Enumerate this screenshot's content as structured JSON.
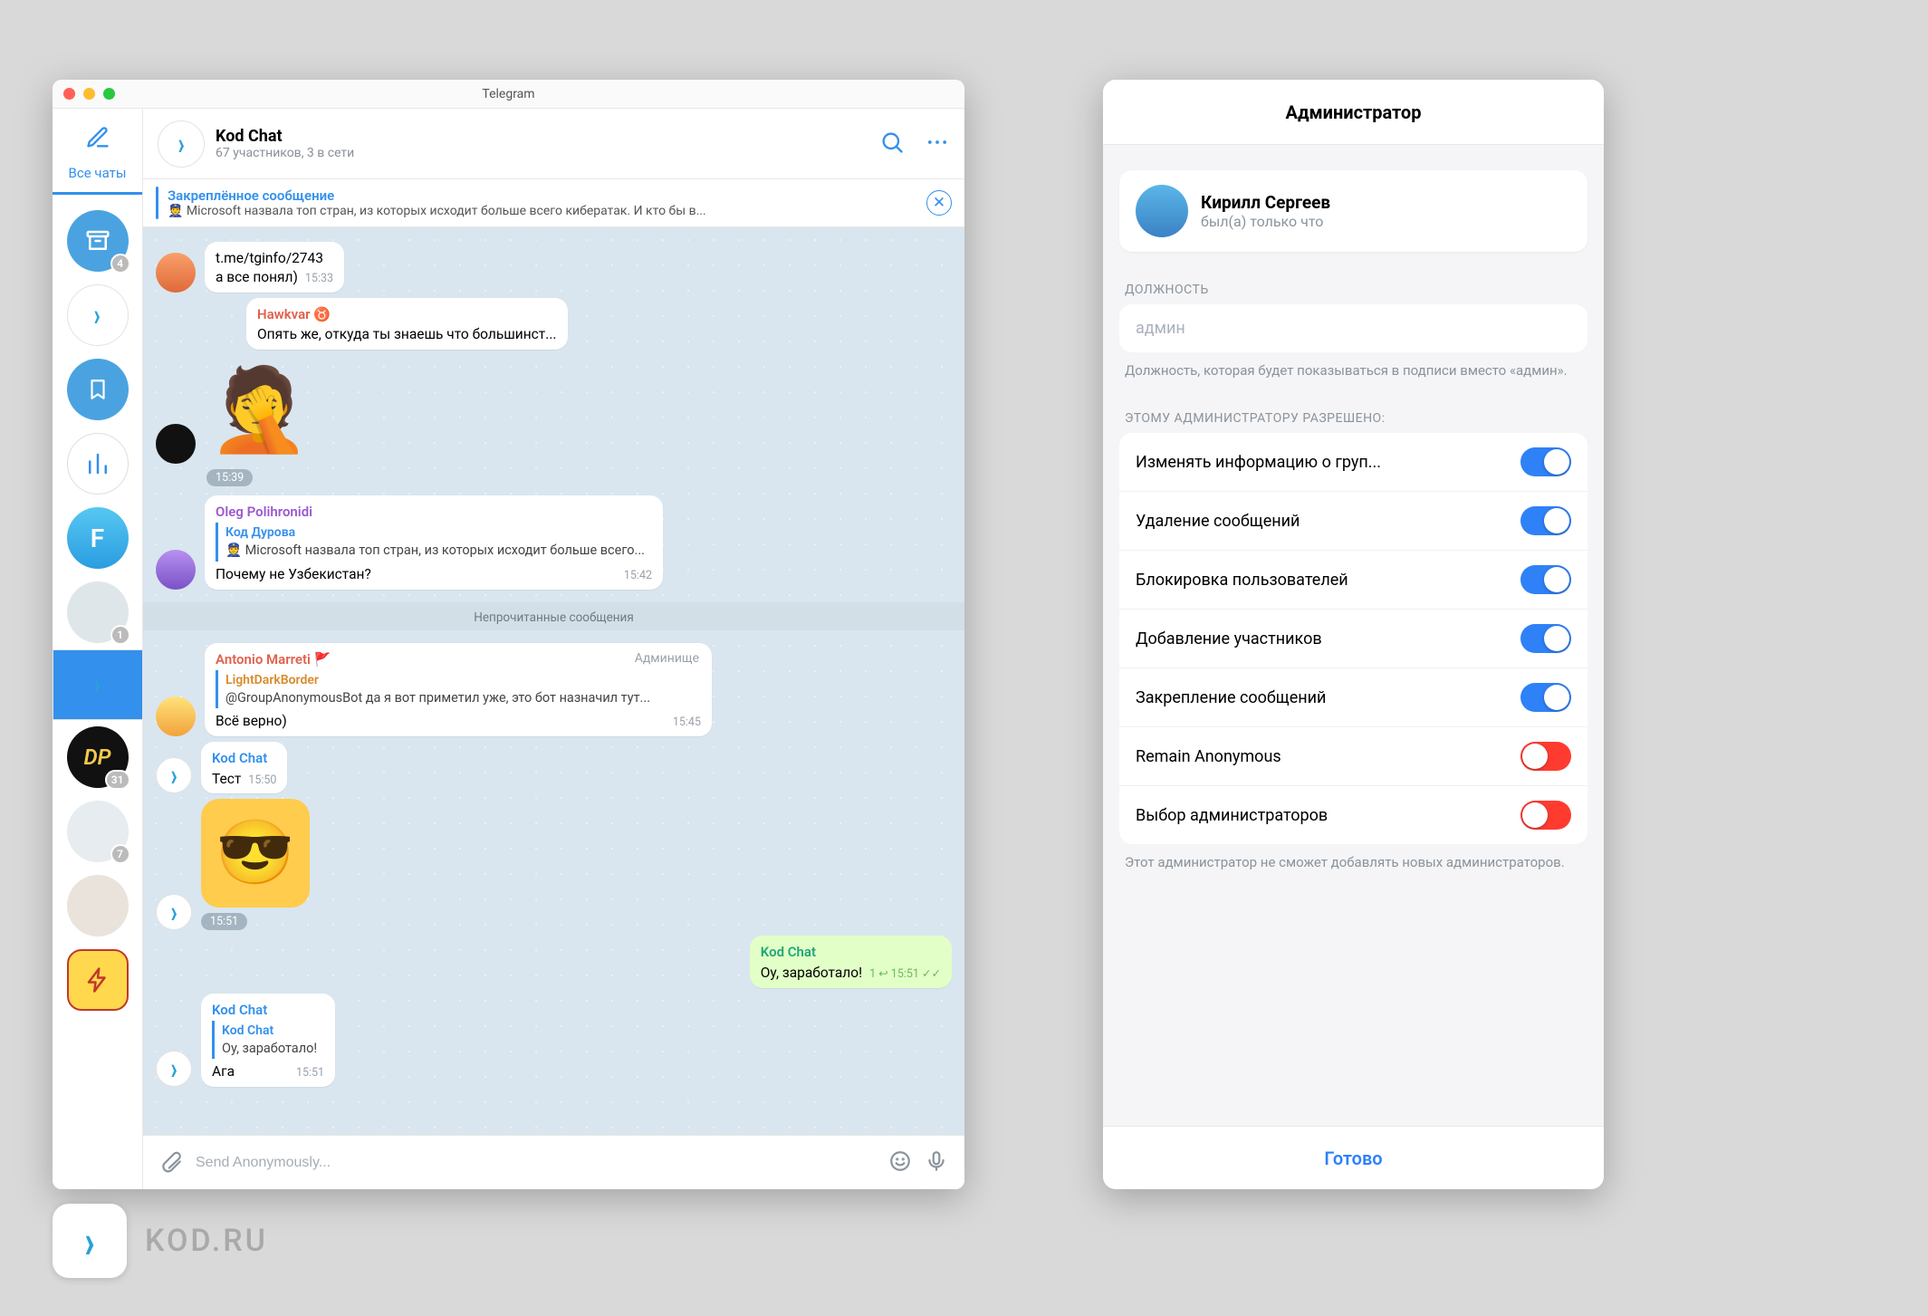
{
  "window": {
    "title": "Telegram"
  },
  "sidebar": {
    "all_chats": "Все чаты",
    "folders": [
      {
        "name": "archive",
        "badge": "4",
        "color": "#4aa3e0",
        "icon": "archive"
      },
      {
        "name": "kod",
        "badge": "",
        "color": "#ffffff",
        "icon": "kod"
      },
      {
        "name": "saved",
        "badge": "",
        "color": "#4aa3e0",
        "icon": "bookmark"
      },
      {
        "name": "stats",
        "badge": "",
        "color": "#ffffff",
        "icon": "bars"
      },
      {
        "name": "f",
        "badge": "",
        "color": "#3bb7f0",
        "text": "F"
      },
      {
        "name": "group1",
        "badge": "1",
        "color": "#cfd7de",
        "icon": "photo"
      },
      {
        "name": "kod-active",
        "badge": "",
        "color": "#3390ec",
        "icon": "kod",
        "selected": true
      },
      {
        "name": "dp",
        "badge": "31",
        "color": "#111111",
        "text": "DP"
      },
      {
        "name": "group2",
        "badge": "7",
        "color": "#dfe6ea",
        "icon": "photo"
      },
      {
        "name": "person",
        "badge": "",
        "color": "#eaeaea",
        "icon": "photo"
      },
      {
        "name": "bolt",
        "badge": "",
        "color": "#ffd84d",
        "icon": "bolt"
      }
    ]
  },
  "chat": {
    "title": "Kod Chat",
    "subtitle": "67 участников, 3 в сети",
    "pinned": {
      "title": "Закреплённое сообщение",
      "text": "👮 Microsoft назвала топ стран, из которых исходит больше всего кибератак. И кто бы в..."
    },
    "unread_divider": "Непрочитанные сообщения",
    "messages": [
      {
        "id": "m1",
        "side": "left",
        "avatar": "bg1",
        "lines": [
          "t.me/tginfo/2743",
          "а все понял)"
        ],
        "time": "15:33"
      },
      {
        "id": "m2",
        "side": "left",
        "avatar": "facepalm",
        "sticker": "facepalm",
        "time": "15:39"
      },
      {
        "id": "m3",
        "side": "left",
        "avatar": "bg4",
        "sender": "Hawkvar ♉",
        "sender_color": "c-red",
        "text": "Опять же, откуда ты знаешь что большинст...",
        "time": ""
      },
      {
        "id": "m4",
        "side": "left",
        "avatar": "bg3",
        "sender": "Oleg Polihronidi",
        "sender_color": "c-purple",
        "reply": {
          "title": "Код Дурова",
          "body": "👮 Microsoft назвала топ стран, из которых исходит больше всего..."
        },
        "text": "Почему не Узбекистан?",
        "time": "15:42"
      },
      {
        "id": "m5",
        "side": "left",
        "avatar": "bg5",
        "sender": "Antonio Marreti 🚩",
        "sender_color": "c-red",
        "role": "Админище",
        "reply": {
          "title": "LightDarkBorder",
          "body": "@GroupAnonymousBot да я вот приметил уже, это бот назначил тут..."
        },
        "text": "Всё верно)",
        "time": "15:45"
      },
      {
        "id": "m6",
        "side": "left",
        "avatar": "kod",
        "sender": "Kod Chat",
        "sender_color": "c-blue",
        "text": "Тест",
        "time": "15:50"
      },
      {
        "id": "m7",
        "side": "left",
        "avatar": "kod",
        "sticker": "cool",
        "time": "15:51"
      },
      {
        "id": "m8",
        "side": "right",
        "out": true,
        "sender": "Kod Chat",
        "sender_color": "c-teal",
        "text": "Оу, заработало!",
        "meta": "1 ↩ 15:51 ✓✓"
      },
      {
        "id": "m9",
        "side": "left",
        "avatar": "kod",
        "sender": "Kod Chat",
        "sender_color": "c-blue",
        "reply": {
          "title": "Kod Chat",
          "body": "Оу, заработало!"
        },
        "text": "Ага",
        "time": "15:51"
      }
    ],
    "composer": {
      "placeholder": "Send Anonymously..."
    }
  },
  "admin": {
    "header": "Администратор",
    "user": {
      "name": "Кирилл Сергеев",
      "status": "был(а) только что"
    },
    "role_label": "ДОЛЖНОСТЬ",
    "role_value": "админ",
    "role_hint": "Должность, которая будет показываться в подписи вместо «админ».",
    "perms_label": "ЭТОМУ АДМИНИСТРАТОРУ РАЗРЕШЕНО:",
    "perms": [
      {
        "label": "Изменять информацию о груп...",
        "on": true
      },
      {
        "label": "Удаление сообщений",
        "on": true
      },
      {
        "label": "Блокировка пользователей",
        "on": true
      },
      {
        "label": "Добавление участников",
        "on": true
      },
      {
        "label": "Закрепление сообщений",
        "on": true
      },
      {
        "label": "Remain Anonymous",
        "on": false
      },
      {
        "label": "Выбор администраторов",
        "on": false
      }
    ],
    "perms_hint": "Этот администратор не сможет добавлять новых администраторов.",
    "done": "Готово"
  },
  "watermark": {
    "text": "KOD.RU"
  }
}
